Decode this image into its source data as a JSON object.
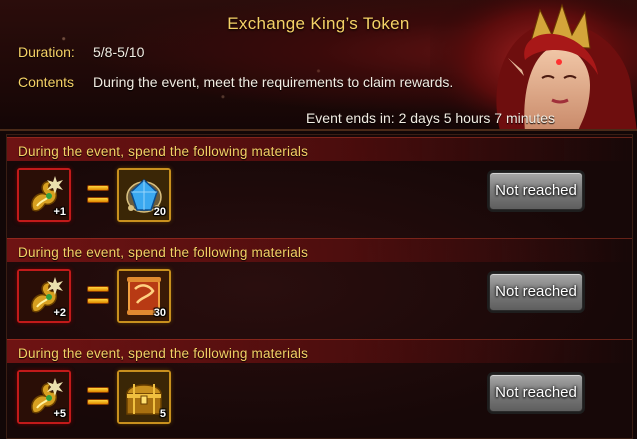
{
  "header": {
    "title": "Exchange King’s Token",
    "duration_label": "Duration:",
    "duration_value": "5/8-5/10",
    "contents_label": "Contents",
    "contents_value": "During the event, meet the requirements to claim rewards.",
    "event_ends": "Event ends in: 2 days 5 hours 7 minutes"
  },
  "sections": [
    {
      "heading": "During the event, spend the following materials",
      "cost_icon": "kings-token-icon",
      "cost_qty": "1",
      "reward_icon": "blue-gem-icon",
      "reward_qty": "20",
      "button_label": "Not reached"
    },
    {
      "heading": "During the event, spend the following materials",
      "cost_icon": "kings-token-icon",
      "cost_qty": "2",
      "reward_icon": "scroll-icon",
      "reward_qty": "30",
      "button_label": "Not reached"
    },
    {
      "heading": "During the event, spend the following materials",
      "cost_icon": "kings-token-icon",
      "cost_qty": "5",
      "reward_icon": "treasure-chest-icon",
      "reward_qty": "5",
      "button_label": "Not reached"
    }
  ],
  "colors": {
    "title_gold": "#f5d266",
    "button_gray": "#7e7e7e",
    "item_border_red": "#c21a1a",
    "item_border_gold": "#c8901e"
  }
}
